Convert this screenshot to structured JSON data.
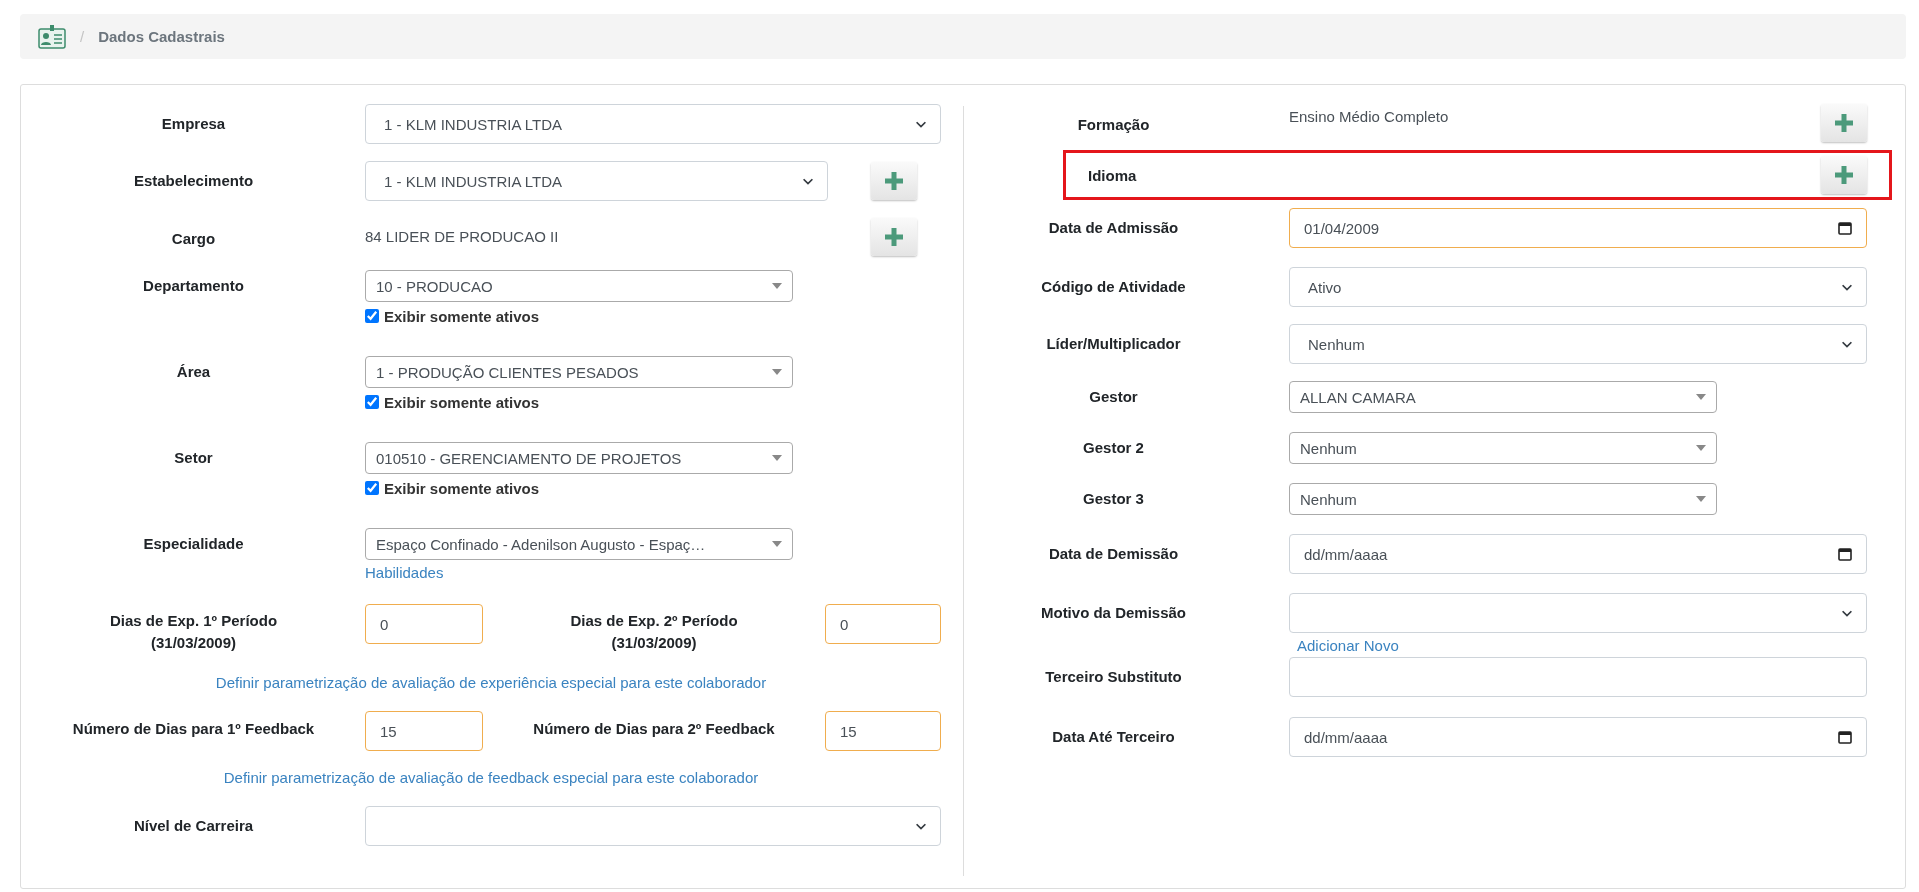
{
  "breadcrumb": {
    "separator": "/",
    "title": "Dados Cadastrais"
  },
  "left_rows": [
    {
      "kind": "select",
      "label": "Empresa",
      "value": "1 - KLM INDUSTRIA LTDA",
      "add_button": false
    },
    {
      "kind": "select",
      "label": "Estabelecimento",
      "value": "1 - KLM INDUSTRIA LTDA",
      "add_button": true
    },
    {
      "kind": "text",
      "label": "Cargo",
      "value": "84 LIDER DE PRODUCAO II",
      "add_button": true
    },
    {
      "kind": "combo",
      "label": "Departamento",
      "value": "10 - PRODUCAO",
      "checkbox": {
        "label": "Exibir somente ativos",
        "checked": true
      }
    },
    {
      "kind": "combo",
      "label": "Área",
      "value": "1 - PRODUÇÃO CLIENTES PESADOS",
      "checkbox": {
        "label": "Exibir somente ativos",
        "checked": true
      }
    },
    {
      "kind": "combo",
      "label": "Setor",
      "value": "010510 - GERENCIAMENTO DE PROJETOS",
      "checkbox": {
        "label": "Exibir somente ativos",
        "checked": true
      }
    },
    {
      "kind": "combo",
      "label": "Especialidade",
      "value": "Espaço Confinado - Adenilson Augusto - Espaç…",
      "link": "Habilidades"
    },
    {
      "kind": "pair",
      "fields": [
        {
          "label": "Dias de Exp. 1º Período",
          "sublabel": "(31/03/2009)",
          "value": "0"
        },
        {
          "label": "Dias de Exp. 2º Período",
          "sublabel": "(31/03/2009)",
          "value": "0"
        }
      ]
    },
    {
      "kind": "link",
      "text": "Definir parametrização de avaliação de experiência especial para este colaborador"
    },
    {
      "kind": "pair",
      "fields": [
        {
          "label": "Número de Dias para 1º Feedback",
          "value": "15"
        },
        {
          "label": "Número de Dias para 2º Feedback",
          "value": "15"
        }
      ]
    },
    {
      "kind": "link",
      "text": "Definir parametrização de avaliação de feedback especial para este colaborador"
    },
    {
      "kind": "select",
      "label": "Nível de Carreira",
      "value": "",
      "add_button": false
    }
  ],
  "right_rows": [
    {
      "kind": "text",
      "label": "Formação",
      "value": "Ensino Médio Completo",
      "add_button": true
    },
    {
      "kind": "marked",
      "label": "Idioma",
      "add_button": true
    },
    {
      "kind": "date",
      "label": "Data de Admissão",
      "value": "01/04/2009",
      "marked": true
    },
    {
      "kind": "select",
      "label": "Código de Atividade",
      "value": "Ativo",
      "add_button": false
    },
    {
      "kind": "select",
      "label": "Líder/Multiplicador",
      "value": "Nenhum",
      "add_button": false
    },
    {
      "kind": "combo",
      "label": "Gestor",
      "value": "ALLAN CAMARA"
    },
    {
      "kind": "combo",
      "label": "Gestor 2",
      "value": "Nenhum"
    },
    {
      "kind": "combo",
      "label": "Gestor 3",
      "value": "Nenhum"
    },
    {
      "kind": "date",
      "label": "Data de Demissão",
      "placeholder": "dd/mm/aaaa",
      "marked": false
    },
    {
      "kind": "select",
      "label": "Motivo da Demissão",
      "value": "",
      "add_button": false,
      "link": "Adicionar Novo"
    },
    {
      "kind": "input",
      "label": "Terceiro Substituto",
      "value": ""
    },
    {
      "kind": "date",
      "label": "Data Até Terceiro",
      "placeholder": "dd/mm/aaaa",
      "marked": false
    }
  ]
}
